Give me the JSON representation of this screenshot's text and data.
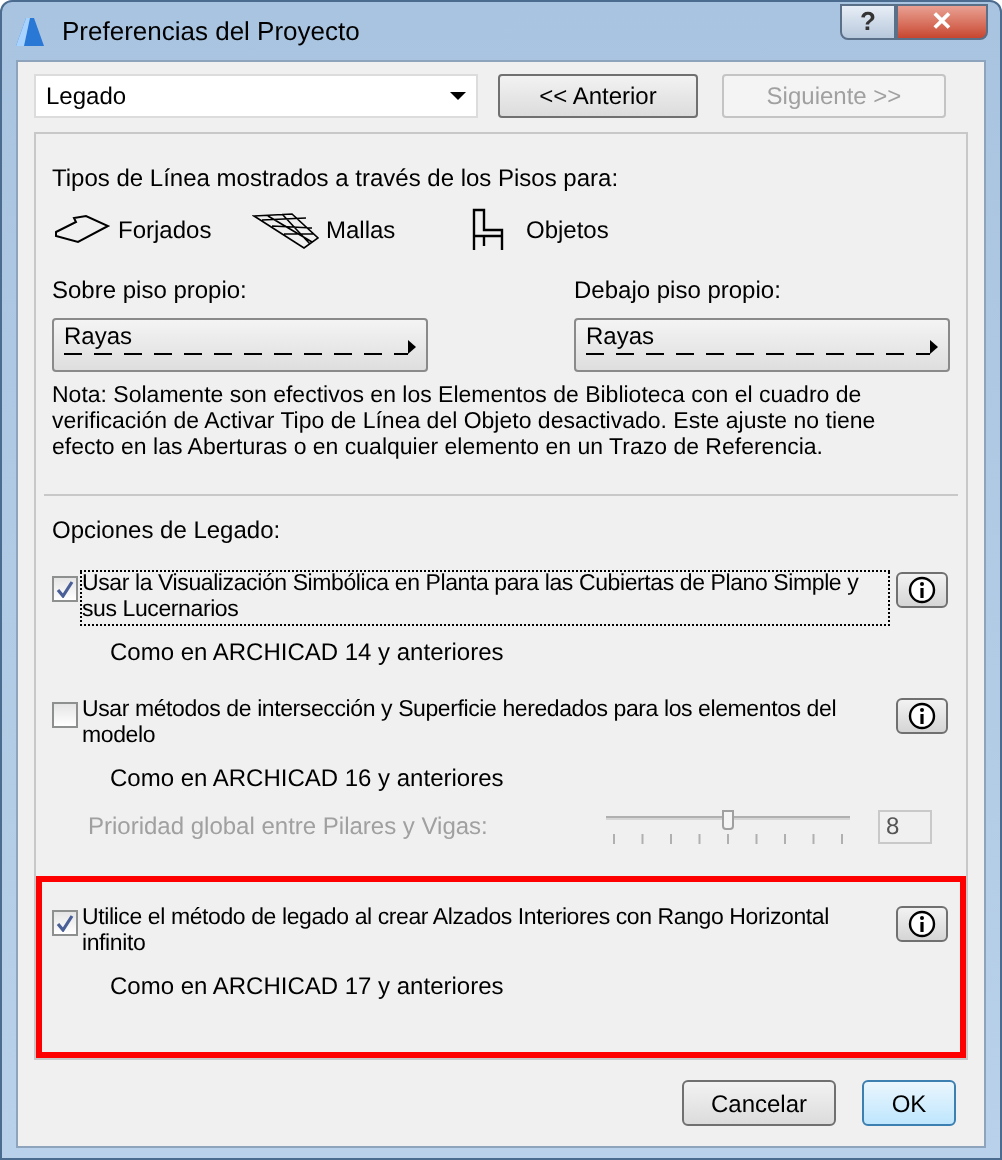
{
  "window": {
    "title": "Preferencias del Proyecto",
    "buttons": [
      "?",
      "✕"
    ]
  },
  "page_select": {
    "value": "Legado"
  },
  "nav": [
    {
      "label": "<< Anterior",
      "disabled": false
    },
    {
      "label": "Siguiente >>",
      "disabled": true
    }
  ],
  "line_types": {
    "heading": "Tipos de Línea mostrados a través de los Pisos para:",
    "elements": [
      {
        "kind": "slab",
        "label": "Forjados"
      },
      {
        "kind": "mesh",
        "label": "Mallas"
      },
      {
        "kind": "chair",
        "label": "Objetos"
      }
    ],
    "selectors": [
      {
        "label": "Sobre piso propio:",
        "value": "Rayas"
      },
      {
        "label": "Debajo piso propio:",
        "value": "Rayas"
      }
    ],
    "note": "Nota: Solamente son efectivos en los Elementos de Biblioteca con el cuadro de verificación de Activar Tipo de Línea del Objeto desactivado. Este ajuste no tiene efecto en las Aberturas o en cualquier elemento en un Trazo de Referencia."
  },
  "legacy": {
    "heading": "Opciones de Legado:",
    "options": [
      {
        "label": "Usar la Visualización Simbólica en Planta para las Cubiertas de Plano Simple y sus Lucernarios",
        "checked": true,
        "focused": true,
        "highlighted": false,
        "note": "Como en ARCHICAD 14 y anteriores"
      },
      {
        "label": "Usar métodos de intersección y Superficie heredados para los elementos del modelo",
        "checked": false,
        "focused": false,
        "highlighted": false,
        "note": "Como en ARCHICAD 16 y anteriores",
        "priority": {
          "label": "Prioridad global entre Pilares y Vigas:",
          "level": 0.5,
          "value": "8",
          "disabled": true
        }
      },
      {
        "label": "Utilice el método de legado al crear Alzados Interiores con Rango Horizontal infinito",
        "checked": true,
        "focused": false,
        "highlighted": true,
        "note": "Como en ARCHICAD 17 y anteriores"
      }
    ]
  },
  "footer": [
    "Cancelar",
    "OK"
  ]
}
